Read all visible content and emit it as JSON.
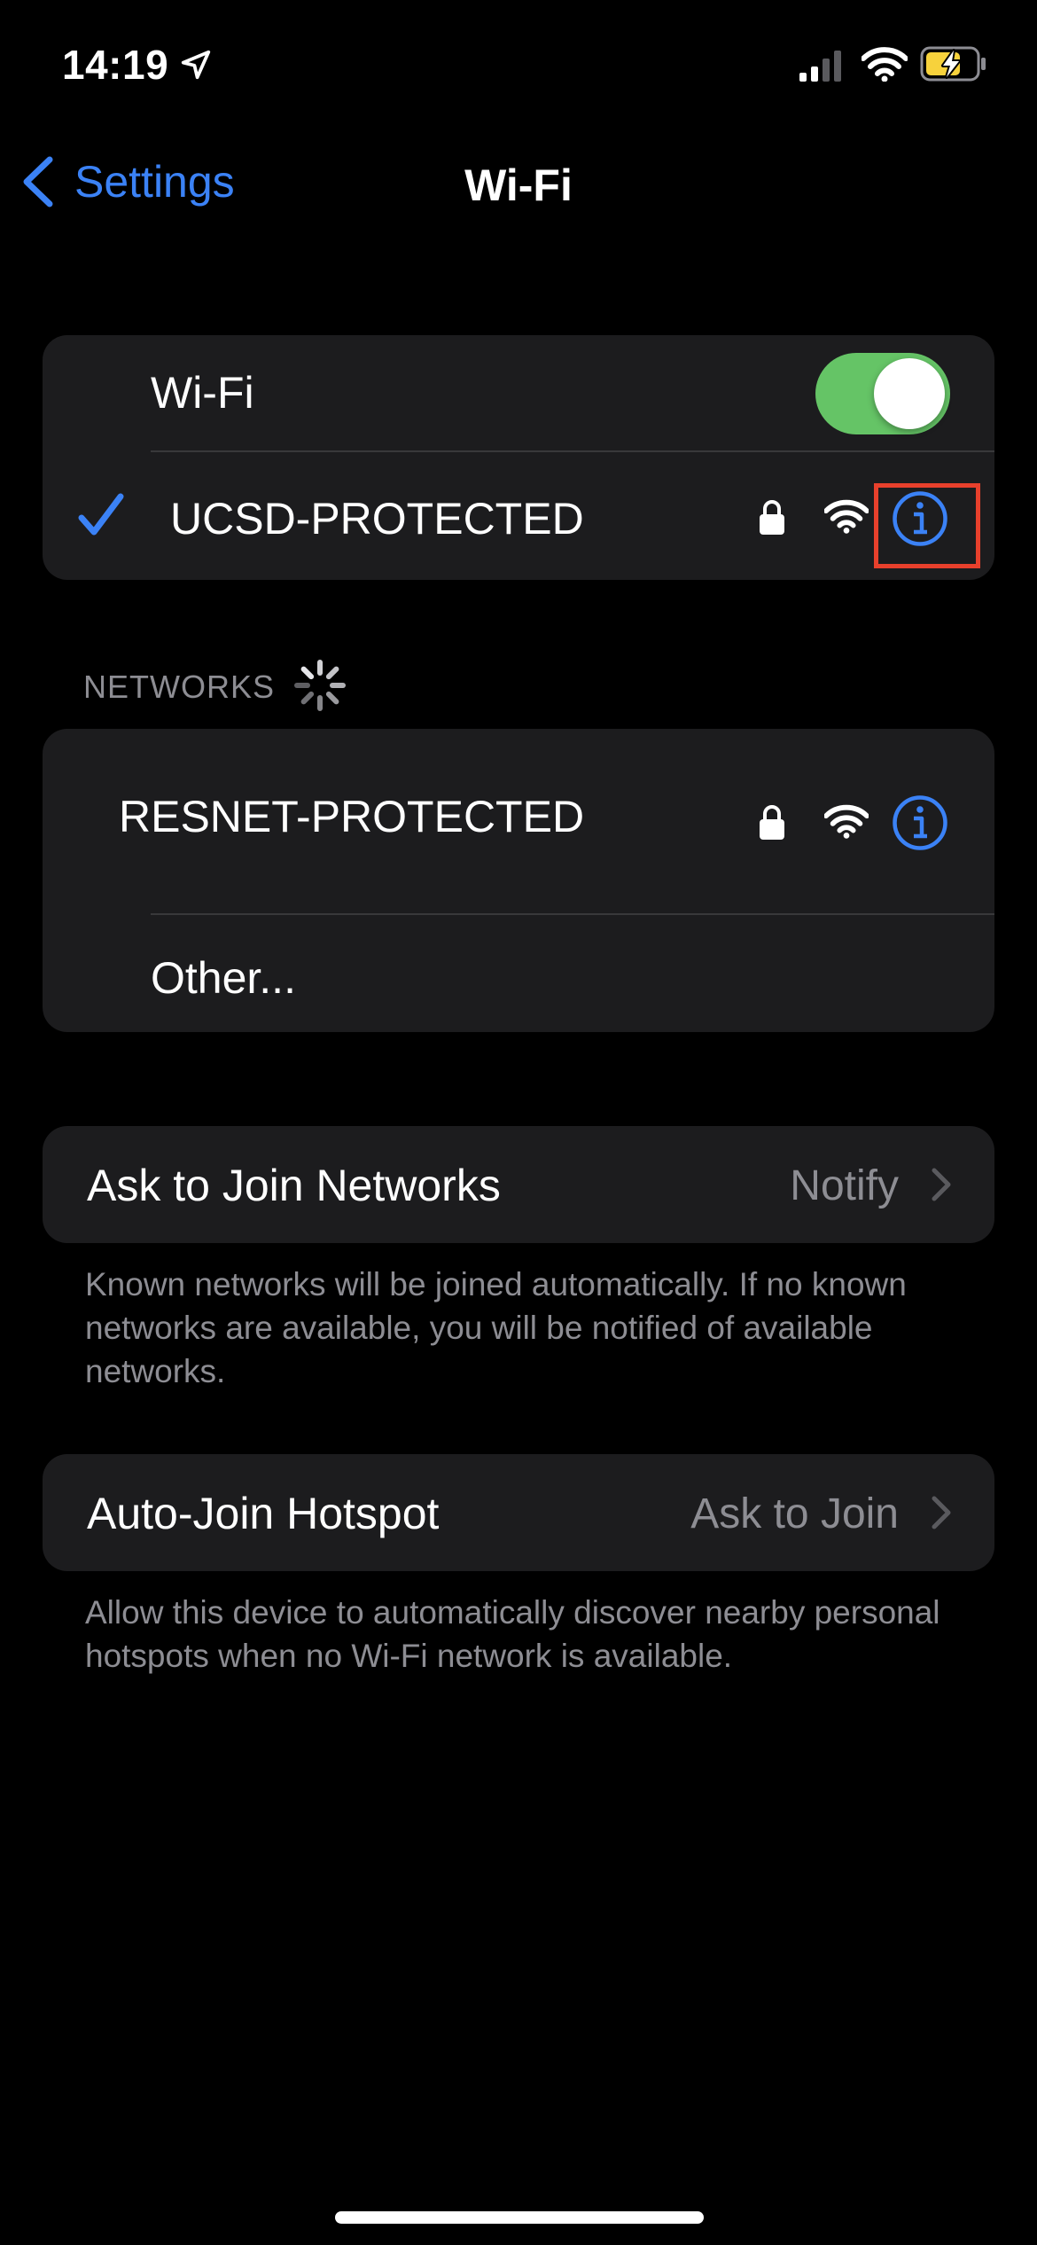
{
  "status_bar": {
    "time": "14:19",
    "location_icon": "location-arrow-icon",
    "signal_icon": "cellular-signal-icon",
    "wifi_icon": "wifi-icon",
    "battery_icon": "battery-charging-icon",
    "battery_color": "#f7d23c"
  },
  "nav": {
    "back_label": "Settings",
    "title": "Wi-Fi"
  },
  "wifi_group": {
    "toggle_label": "Wi-Fi",
    "toggle_on": true,
    "toggle_color": "#65c466",
    "connected_network": {
      "name": "UCSD-PROTECTED",
      "secured": true,
      "info_icon": "info-icon"
    }
  },
  "networks_section": {
    "header": "NETWORKS",
    "items": [
      {
        "name": "RESNET-PROTECTED",
        "secured": true
      },
      {
        "name": "Other..."
      }
    ]
  },
  "ask_to_join": {
    "label": "Ask to Join Networks",
    "value": "Notify",
    "footnote": "Known networks will be joined automatically. If no known networks are available, you will be notified of available networks."
  },
  "auto_join_hotspot": {
    "label": "Auto-Join Hotspot",
    "value": "Ask to Join",
    "footnote": "Allow this device to automatically discover nearby personal hotspots when no Wi-Fi network is available."
  },
  "colors": {
    "accent": "#3b82f6",
    "highlight_box": "#e8402c",
    "group_background": "#1c1c1e",
    "secondary_text": "#8d8d93"
  }
}
